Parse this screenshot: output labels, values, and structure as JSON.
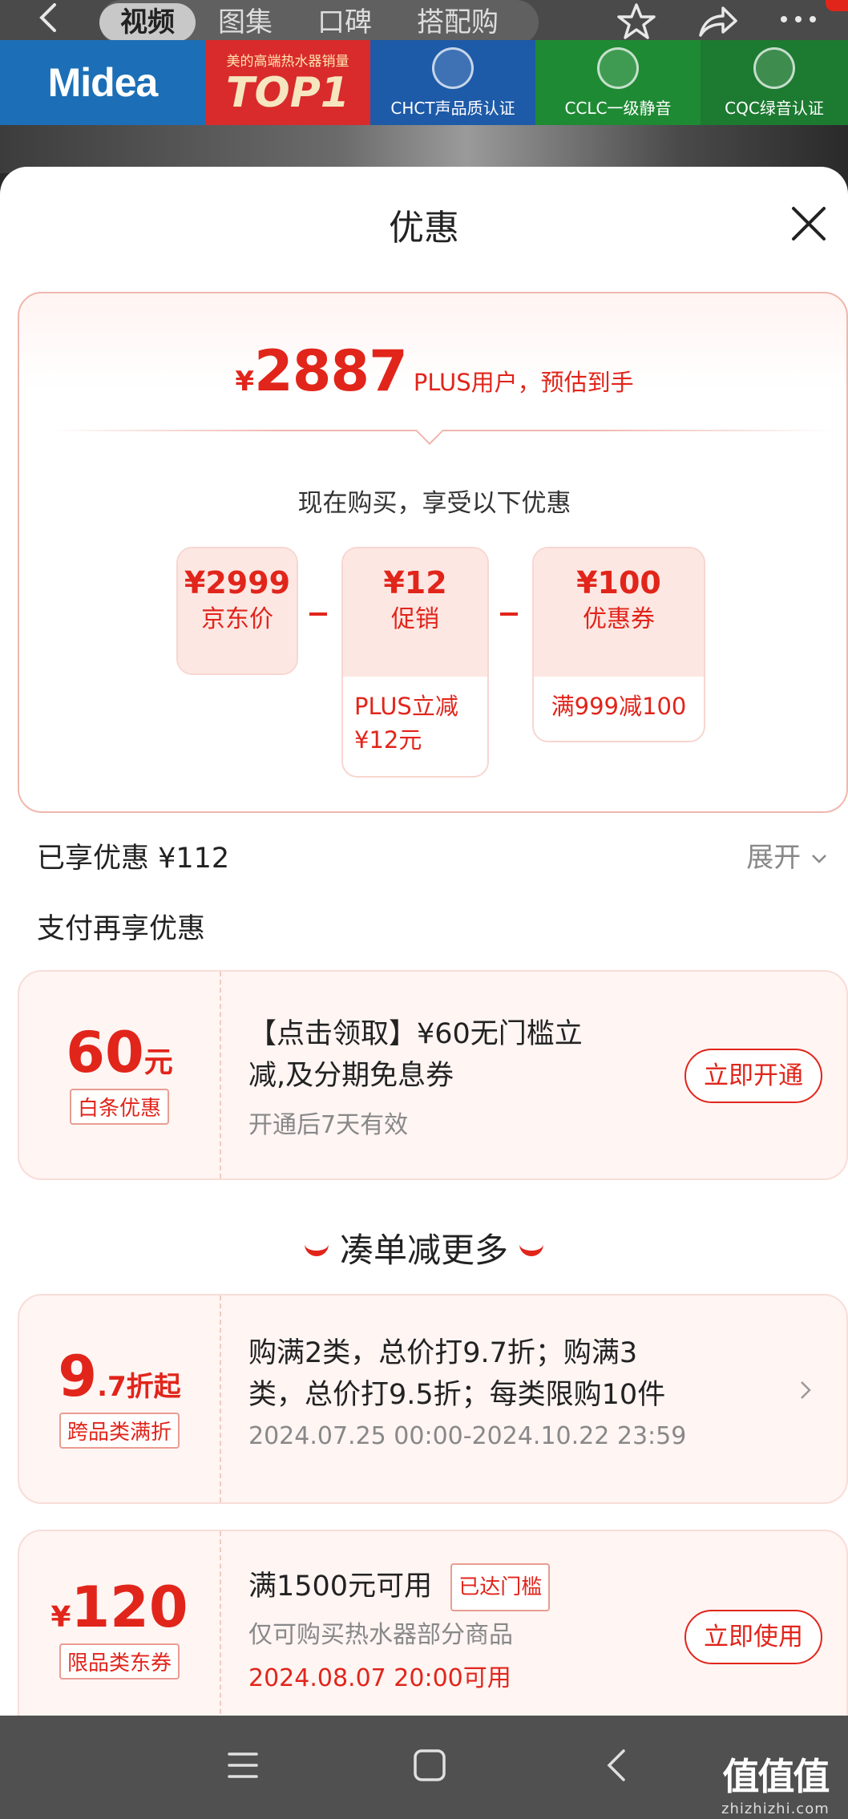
{
  "topnav": {
    "tabs": [
      "视频",
      "图集",
      "口碑",
      "搭配购"
    ],
    "active_tab": 0
  },
  "banner": {
    "brand": "Midea",
    "top1_small": "美的高端热水器销量",
    "top1_big": "TOP1",
    "certs": [
      "CHCT声品质认证",
      "CCLC一级静音",
      "CQC绿音认证"
    ]
  },
  "sheet": {
    "title": "优惠"
  },
  "price_card": {
    "currency": "¥",
    "final_price": "2887",
    "final_desc": "PLUS用户，预估到手",
    "subtitle": "现在购买，享受以下优惠",
    "tiles": [
      {
        "amount": "¥2999",
        "label": "京东价",
        "note": ""
      },
      {
        "amount": "¥12",
        "label": "促销",
        "note": "PLUS立减 ¥12元"
      },
      {
        "amount": "¥100",
        "label": "优惠券",
        "note": "满999减100"
      }
    ]
  },
  "enjoyed": {
    "label": "已享优惠 ¥112",
    "expand": "展开"
  },
  "pay_more": {
    "label": "支付再享优惠"
  },
  "baitiao": {
    "amount": "60",
    "unit": "元",
    "tag": "白条优惠",
    "title_line1": "【点击领取】¥60无门槛立",
    "title_line2": "减,及分期免息券",
    "sub": "开通后7天有效",
    "button": "立即开通"
  },
  "bundle_heading": "凑单减更多",
  "discount": {
    "big": "9",
    "small": ".7折起",
    "tag": "跨品类满折",
    "line1": "购满2类，总价打9.7折；购满3",
    "line2": "类，总价打9.5折；每类限购10件",
    "period": "2024.07.25 00:00-2024.10.22 23:59"
  },
  "coupon": {
    "currency": "¥",
    "amount": "120",
    "tag": "限品类东券",
    "title": "满1500元可用",
    "badge": "已达门槛",
    "sub": "仅可购买热水器部分商品",
    "time": "2024.08.07 20:00可用",
    "button": "立即使用"
  },
  "watermark": {
    "cn": "值值值",
    "en": "zhizhizhi.com"
  },
  "colors": {
    "accent": "#e1251b",
    "tile_bg": "#fde7e3",
    "card_border": "#f0b7ae"
  }
}
